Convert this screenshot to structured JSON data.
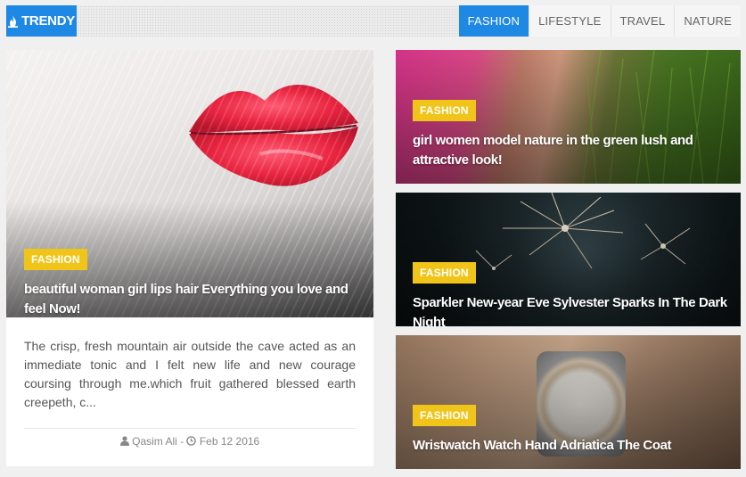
{
  "brand": {
    "name": "TRENDY",
    "color": "#1e88e5"
  },
  "nav": {
    "items": [
      {
        "label": "FASHION",
        "active": true
      },
      {
        "label": "LIFESTYLE",
        "active": false
      },
      {
        "label": "TRAVEL",
        "active": false
      },
      {
        "label": "NATURE",
        "active": false
      }
    ]
  },
  "featured": {
    "tag": "FASHION",
    "title": "beautiful woman girl lips hair Everything you love and feel Now!",
    "excerpt": "The crisp, fresh mountain air outside the cave acted as an immediate tonic and I felt new life and new courage coursing through me.which fruit gathered blessed earth creepeth, c...",
    "author": "Qasim Ali",
    "separator": "-",
    "date": "Feb 12 2016",
    "author_icon": "user-icon",
    "date_icon": "clock-icon"
  },
  "side_posts": [
    {
      "tag": "FASHION",
      "title": "girl women model nature in the green lush and attractive look!"
    },
    {
      "tag": "FASHION",
      "title": "Sparkler New-year Eve Sylvester Sparks In The Dark Night"
    },
    {
      "tag": "FASHION",
      "title": "Wristwatch Watch Hand Adriatica The Coat"
    }
  ],
  "colors": {
    "accent": "#1e88e5",
    "tag": "#f0c419",
    "background": "#f0f0f0"
  }
}
